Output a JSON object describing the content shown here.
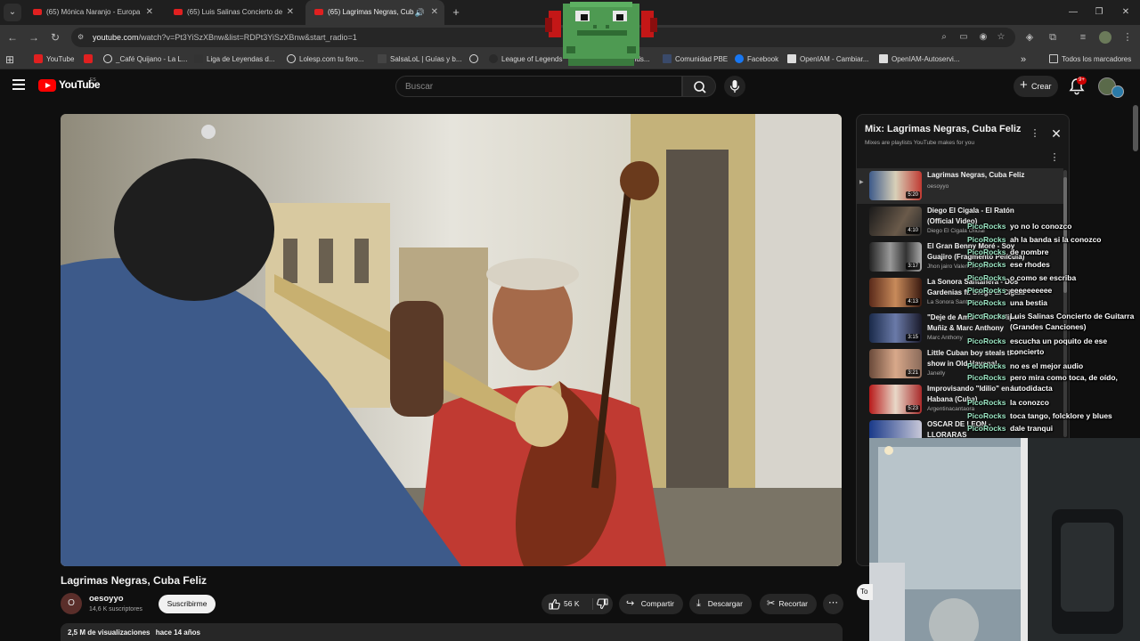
{
  "browser": {
    "tabs": [
      {
        "title": "(65) Mónica Naranjo - Europa (",
        "active": false
      },
      {
        "title": "(65) Luis Salinas Concierto de G",
        "active": false
      },
      {
        "title": "(65) Lagrimas Negras, Cuba",
        "active": true
      }
    ],
    "url_host": "youtube.com",
    "url_rest": "/watch?v=Pt3YiSzXBnw&list=RDPt3YiSzXBnw&start_radio=1",
    "bookmarks": [
      "YouTube",
      "",
      "_Café Quijano - La L...",
      "Liga de Leyendas d...",
      "Lolesp.com tu foro...",
      "SalsaLoL | Guías y b...",
      "",
      "League of Legends",
      "...egends...",
      "Comunidad PBE",
      "Facebook",
      "OpenIAM - Cambiar...",
      "OpenIAM-Autoservi..."
    ],
    "bookmarks_all": "Todos los marcadores"
  },
  "youtube": {
    "logo_word": "YouTube",
    "region": "ES",
    "search_placeholder": "Buscar",
    "create_label": "Crear",
    "notif_count": "9+"
  },
  "video": {
    "title": "Lagrimas Negras, Cuba Feliz",
    "channel": "oesoyyo",
    "channel_initial": "O",
    "subscribers": "14,6 K suscriptores",
    "subscribe_label": "Suscribirme",
    "likes": "56 K",
    "share_label": "Compartir",
    "download_label": "Descargar",
    "clip_label": "Recortar",
    "views": "2,5 M de visualizaciones",
    "age": "hace 14 años"
  },
  "mix": {
    "title": "Mix: Lagrimas Negras, Cuba Feliz",
    "subtitle": "Mixes are playlists YouTube makes for you",
    "items": [
      {
        "title": "Lagrimas Negras, Cuba Feliz",
        "channel": "oesoyyo",
        "duration": "5:20",
        "current": true
      },
      {
        "title": "Diego El Cigala - El Ratón (Official Video)",
        "channel": "Diego El Cigala Oficial",
        "duration": "4:10",
        "current": false
      },
      {
        "title": "El Gran Benny Moré - Soy Guajiro (Fragmento Película)",
        "channel": "Jhon jairo Valencia garcia",
        "duration": "3:17",
        "current": false
      },
      {
        "title": "La Sonora Santanera - Dos Gardenias ft. Diego El Cigala",
        "channel": "La Sonora Santanera",
        "duration": "4:13",
        "current": false
      },
      {
        "title": "\"Deje de Amar\" Don Felipe Muñiz & Marc Anthony (Offici...",
        "channel": "Marc Anthony",
        "duration": "3:15",
        "current": false
      },
      {
        "title": "Little Cuban boy steals the show in Old Havana! Dancin...",
        "channel": "Janelly",
        "duration": "3:21",
        "current": false
      },
      {
        "title": "Improvisando \"Idilio\" en La Habana (Cuba)",
        "channel": "Argentinacantaora",
        "duration": "5:23",
        "current": false
      },
      {
        "title": "OSCAR DE LEON - LLORARAS",
        "channel": "",
        "duration": "",
        "current": false
      }
    ]
  },
  "chat": {
    "user": "PicoRocks",
    "messages": [
      "yo no lo conozco",
      "ah la banda si la conozco",
      "de nombre",
      "ese rhodes",
      "o como se escriba",
      "eeeeeeeeee",
      "una bestia",
      "Luis Salinas Concierto de Guitarra (Grandes Canciones)",
      "escucha un poquito de ese concierto",
      "no es el mejor audio",
      "pero mira como toca, de oído, autodidacta",
      "la conozco",
      "toca tango, folcklore y blues",
      "dale tranqui"
    ]
  },
  "colors": {
    "accent": "#ff0000",
    "chat_user": "#9ee9c6",
    "bg": "#0f0f0f"
  },
  "icons": [
    "search-icon",
    "mic-icon",
    "bell-icon",
    "like-icon",
    "dislike-icon",
    "share-icon",
    "download-icon",
    "scissors-icon",
    "more-icon",
    "close-icon"
  ],
  "partial_button": "To"
}
